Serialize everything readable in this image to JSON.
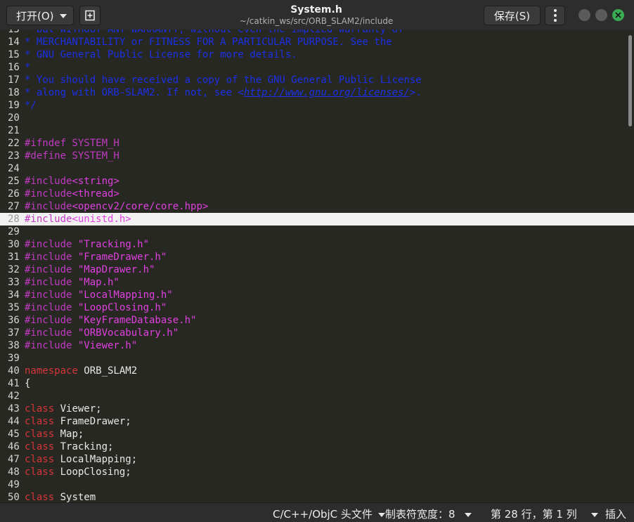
{
  "header": {
    "open_label": "打开(O)",
    "title": "System.h",
    "path": "~/catkin_ws/src/ORB_SLAM2/include",
    "save_label": "保存(S)"
  },
  "icons": {
    "new_document": "new-document-icon",
    "menu": "vertical-dots-menu-icon",
    "minimize": "minimize-icon",
    "maximize": "maximize-icon",
    "close": "close-icon"
  },
  "colors": {
    "comment": "#1c2fe8",
    "preprocessor": "#c13ac2",
    "string": "#e040e0",
    "keyword": "#d6363a",
    "close_button": "#3aab53"
  },
  "editor": {
    "current_line": 28,
    "lines": [
      {
        "n": "13",
        "cut": true,
        "tokens": [
          {
            "t": "comment",
            "v": "* but WITHOUT ANY WARRANTY; without even the implied warranty of"
          }
        ]
      },
      {
        "n": "14",
        "tokens": [
          {
            "t": "comment",
            "v": "* MERCHANTABILITY or FITNESS FOR A PARTICULAR PURPOSE. See the"
          }
        ]
      },
      {
        "n": "15",
        "tokens": [
          {
            "t": "comment",
            "v": "* GNU General Public License for more details."
          }
        ]
      },
      {
        "n": "16",
        "tokens": [
          {
            "t": "comment",
            "v": "*"
          }
        ]
      },
      {
        "n": "17",
        "tokens": [
          {
            "t": "comment",
            "v": "* You should have received a copy of the GNU General Public License"
          }
        ]
      },
      {
        "n": "18",
        "tokens": [
          {
            "t": "comment",
            "v": "* along with ORB-SLAM2. If not, see <"
          },
          {
            "t": "link",
            "v": "http://www.gnu.org/licenses/"
          },
          {
            "t": "comment",
            "v": ">."
          }
        ]
      },
      {
        "n": "19",
        "tokens": [
          {
            "t": "comment",
            "v": "*/"
          }
        ]
      },
      {
        "n": "20",
        "tokens": []
      },
      {
        "n": "21",
        "tokens": []
      },
      {
        "n": "22",
        "tokens": [
          {
            "t": "pre",
            "v": "#ifndef SYSTEM_H"
          }
        ]
      },
      {
        "n": "23",
        "tokens": [
          {
            "t": "pre",
            "v": "#define SYSTEM_H"
          }
        ]
      },
      {
        "n": "24",
        "tokens": []
      },
      {
        "n": "25",
        "tokens": [
          {
            "t": "pre",
            "v": "#include"
          },
          {
            "t": "str",
            "v": "<string>"
          }
        ]
      },
      {
        "n": "26",
        "tokens": [
          {
            "t": "pre",
            "v": "#include"
          },
          {
            "t": "str",
            "v": "<thread>"
          }
        ]
      },
      {
        "n": "27",
        "tokens": [
          {
            "t": "pre",
            "v": "#include"
          },
          {
            "t": "str",
            "v": "<opencv2/core/core.hpp>"
          }
        ]
      },
      {
        "n": "28",
        "tokens": [
          {
            "t": "pre",
            "v": "#include"
          },
          {
            "t": "str",
            "v": "<unistd.h>"
          }
        ]
      },
      {
        "n": "29",
        "tokens": []
      },
      {
        "n": "30",
        "tokens": [
          {
            "t": "pre",
            "v": "#include "
          },
          {
            "t": "str",
            "v": "\"Tracking.h\""
          }
        ]
      },
      {
        "n": "31",
        "tokens": [
          {
            "t": "pre",
            "v": "#include "
          },
          {
            "t": "str",
            "v": "\"FrameDrawer.h\""
          }
        ]
      },
      {
        "n": "32",
        "tokens": [
          {
            "t": "pre",
            "v": "#include "
          },
          {
            "t": "str",
            "v": "\"MapDrawer.h\""
          }
        ]
      },
      {
        "n": "33",
        "tokens": [
          {
            "t": "pre",
            "v": "#include "
          },
          {
            "t": "str",
            "v": "\"Map.h\""
          }
        ]
      },
      {
        "n": "34",
        "tokens": [
          {
            "t": "pre",
            "v": "#include "
          },
          {
            "t": "str",
            "v": "\"LocalMapping.h\""
          }
        ]
      },
      {
        "n": "35",
        "tokens": [
          {
            "t": "pre",
            "v": "#include "
          },
          {
            "t": "str",
            "v": "\"LoopClosing.h\""
          }
        ]
      },
      {
        "n": "36",
        "tokens": [
          {
            "t": "pre",
            "v": "#include "
          },
          {
            "t": "str",
            "v": "\"KeyFrameDatabase.h\""
          }
        ]
      },
      {
        "n": "37",
        "tokens": [
          {
            "t": "pre",
            "v": "#include "
          },
          {
            "t": "str",
            "v": "\"ORBVocabulary.h\""
          }
        ]
      },
      {
        "n": "38",
        "tokens": [
          {
            "t": "pre",
            "v": "#include "
          },
          {
            "t": "str",
            "v": "\"Viewer.h\""
          }
        ]
      },
      {
        "n": "39",
        "tokens": []
      },
      {
        "n": "40",
        "tokens": [
          {
            "t": "kw",
            "v": "namespace"
          },
          {
            "t": "plain",
            "v": " ORB_SLAM2"
          }
        ]
      },
      {
        "n": "41",
        "tokens": [
          {
            "t": "plain",
            "v": "{"
          }
        ]
      },
      {
        "n": "42",
        "tokens": []
      },
      {
        "n": "43",
        "tokens": [
          {
            "t": "kw",
            "v": "class"
          },
          {
            "t": "plain",
            "v": " Viewer;"
          }
        ]
      },
      {
        "n": "44",
        "tokens": [
          {
            "t": "kw",
            "v": "class"
          },
          {
            "t": "plain",
            "v": " FrameDrawer;"
          }
        ]
      },
      {
        "n": "45",
        "tokens": [
          {
            "t": "kw",
            "v": "class"
          },
          {
            "t": "plain",
            "v": " Map;"
          }
        ]
      },
      {
        "n": "46",
        "tokens": [
          {
            "t": "kw",
            "v": "class"
          },
          {
            "t": "plain",
            "v": " Tracking;"
          }
        ]
      },
      {
        "n": "47",
        "tokens": [
          {
            "t": "kw",
            "v": "class"
          },
          {
            "t": "plain",
            "v": " LocalMapping;"
          }
        ]
      },
      {
        "n": "48",
        "tokens": [
          {
            "t": "kw",
            "v": "class"
          },
          {
            "t": "plain",
            "v": " LoopClosing;"
          }
        ]
      },
      {
        "n": "49",
        "tokens": []
      },
      {
        "n": "50",
        "tokens": [
          {
            "t": "kw",
            "v": "class"
          },
          {
            "t": "plain",
            "v": " System"
          }
        ]
      }
    ]
  },
  "statusbar": {
    "language": "C/C++/ObjC 头文件",
    "tab_width": "制表符宽度：8",
    "position": "第 28 行，第 1 列",
    "insert_mode": "插入"
  }
}
